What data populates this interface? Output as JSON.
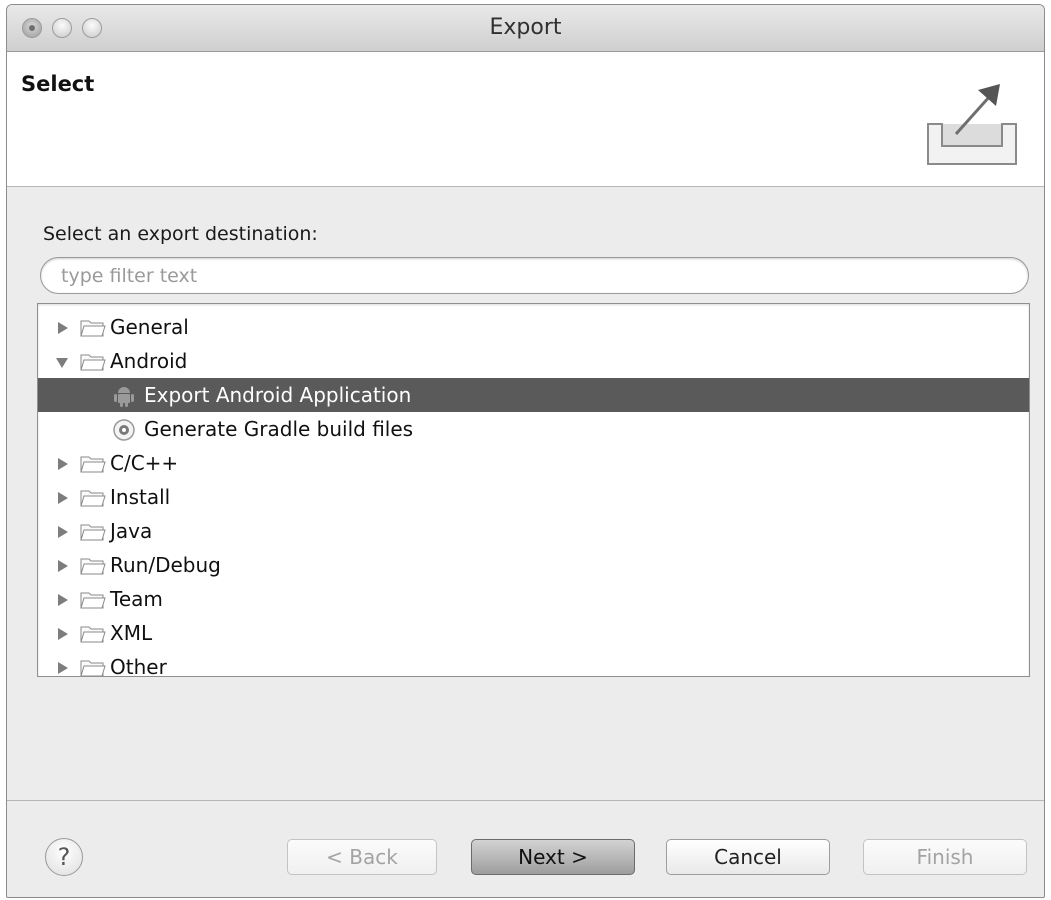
{
  "window": {
    "title": "Export"
  },
  "header": {
    "title": "Select"
  },
  "prompt": "Select an export destination:",
  "filter": {
    "placeholder": "type filter text",
    "value": ""
  },
  "tree": {
    "items": [
      {
        "label": "General",
        "expanded": false
      },
      {
        "label": "Android",
        "expanded": true
      },
      {
        "label": "Export Android Application",
        "selected": true,
        "icon": "android-icon"
      },
      {
        "label": "Generate Gradle build files",
        "icon": "gradle-icon"
      },
      {
        "label": "C/C++",
        "expanded": false
      },
      {
        "label": "Install",
        "expanded": false
      },
      {
        "label": "Java",
        "expanded": false
      },
      {
        "label": "Run/Debug",
        "expanded": false
      },
      {
        "label": "Team",
        "expanded": false
      },
      {
        "label": "XML",
        "expanded": false
      },
      {
        "label": "Other",
        "expanded": false
      }
    ]
  },
  "buttons": {
    "help": "?",
    "back": "< Back",
    "next": "Next >",
    "cancel": "Cancel",
    "finish": "Finish"
  },
  "colors": {
    "selection": "#5a5a5a",
    "background": "#ececec"
  }
}
